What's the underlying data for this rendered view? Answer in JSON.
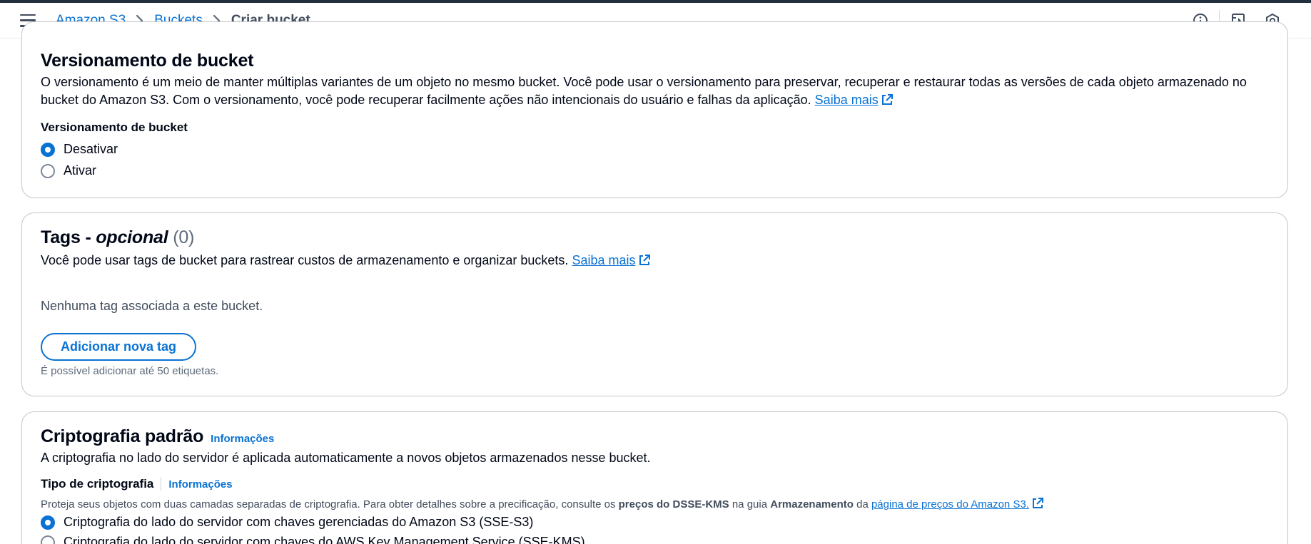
{
  "breadcrumb": {
    "items": [
      "Amazon S3",
      "Buckets"
    ],
    "current": "Criar bucket"
  },
  "header_icons": [
    "info-icon",
    "changelog-icon",
    "settings-hex-icon"
  ],
  "versioning": {
    "title": "Versionamento de bucket",
    "description": "O versionamento é um meio de manter múltiplas variantes de um objeto no mesmo bucket. Você pode usar o versionamento para preservar, recuperar e restaurar todas as versões de cada objeto armazenado no bucket do Amazon S3. Com o versionamento, você pode recuperar facilmente ações não intencionais do usuário e falhas da aplicação.",
    "learn_more": "Saiba mais",
    "field_label": "Versionamento de bucket",
    "options": [
      "Desativar",
      "Ativar"
    ],
    "selected": "Desativar"
  },
  "tags": {
    "title": "Tags -",
    "optional": "opcional",
    "count": "(0)",
    "description": "Você pode usar tags de bucket para rastrear custos de armazenamento e organizar buckets.",
    "learn_more": "Saiba mais",
    "empty_message": "Nenhuma tag associada a este bucket.",
    "add_button": "Adicionar nova tag",
    "limit_hint": "É possível adicionar até 50 etiquetas."
  },
  "encryption": {
    "title": "Criptografia padrão",
    "info": "Informações",
    "description": "A criptografia no lado do servidor é aplicada automaticamente a novos objetos armazenados nesse bucket.",
    "type_label": "Tipo de criptografia",
    "type_info": "Informações",
    "constraint_pre": "Proteja seus objetos com duas camadas separadas de criptografia. Para obter detalhes sobre a precificação, consulte os",
    "constraint_bold1": "preços do DSSE-KMS",
    "constraint_mid": "na guia",
    "constraint_bold2": "Armazenamento",
    "constraint_da": "da",
    "constraint_link": "página de preços do Amazon S3.",
    "options": [
      "Criptografia do lado do servidor com chaves gerenciadas do Amazon S3 (SSE-S3)",
      "Criptografia do lado do servidor com chaves do AWS Key Management Service (SSE-KMS)"
    ],
    "selected": "Criptografia do lado do servidor com chaves gerenciadas do Amazon S3 (SSE-S3)"
  },
  "colors": {
    "link": "#0972d3",
    "text": "#000716",
    "border": "#c6c6cd"
  }
}
